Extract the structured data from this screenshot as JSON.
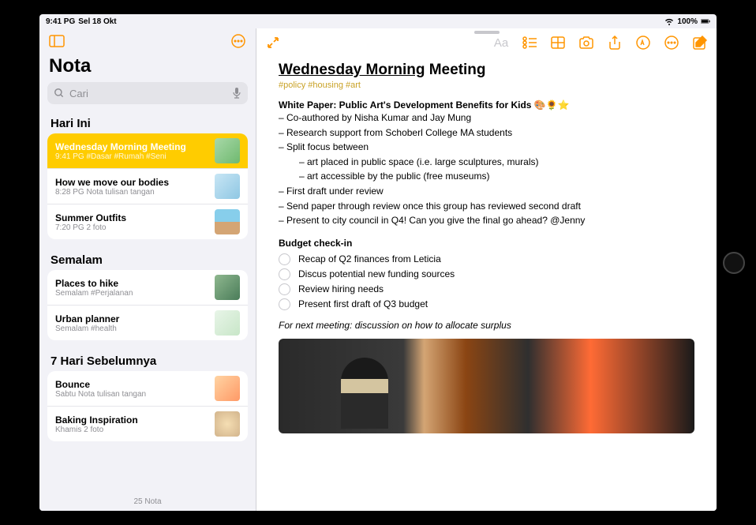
{
  "status": {
    "time": "9:41 PG",
    "date": "Sel 18 Okt",
    "battery": "100%"
  },
  "sidebar": {
    "title": "Nota",
    "search_placeholder": "Cari",
    "footer": "25 Nota",
    "sections": [
      {
        "header": "Hari Ini",
        "notes": [
          {
            "title": "Wednesday Morning Meeting",
            "sub": "9:41 PG  #Dasar #Rumah #Seni",
            "selected": true
          },
          {
            "title": "How we move our bodies",
            "sub": "8:28 PG  Nota tulisan tangan"
          },
          {
            "title": "Summer Outfits",
            "sub": "7:20 PG  2 foto"
          }
        ]
      },
      {
        "header": "Semalam",
        "notes": [
          {
            "title": "Places to hike",
            "sub": "Semalam  #Perjalanan"
          },
          {
            "title": "Urban planner",
            "sub": "Semalam  #health"
          }
        ]
      },
      {
        "header": "7 Hari Sebelumnya",
        "notes": [
          {
            "title": "Bounce",
            "sub": "Sabtu  Nota tulisan tangan"
          },
          {
            "title": "Baking Inspiration",
            "sub": "Khamis  2 foto"
          }
        ]
      }
    ]
  },
  "note": {
    "title_underline": "Wednesday Morning",
    "title_rest": " Meeting",
    "tags": "#policy #housing #art",
    "section1_title": "White Paper: Public Art's Development Benefits for Kids 🎨🌻⭐",
    "lines": [
      "– Co-authored by Nisha Kumar and Jay Mung",
      "– Research support from Schoberl College MA students",
      "– Split focus between"
    ],
    "indented": [
      "– art placed in public space (i.e. large sculptures, murals)",
      "– art accessible by the public (free museums)"
    ],
    "lines2": [
      "– First draft under review",
      "– Send paper through review once this group has reviewed second draft",
      "– Present to city council in Q4! Can you give the final go ahead? @Jenny"
    ],
    "section2_title": "Budget check-in",
    "checklist": [
      "Recap of Q2 finances from Leticia",
      "Discus potential new funding sources",
      "Review hiring needs",
      "Present first draft of Q3 budget"
    ],
    "italic": "For next meeting: discussion on how to allocate surplus"
  }
}
